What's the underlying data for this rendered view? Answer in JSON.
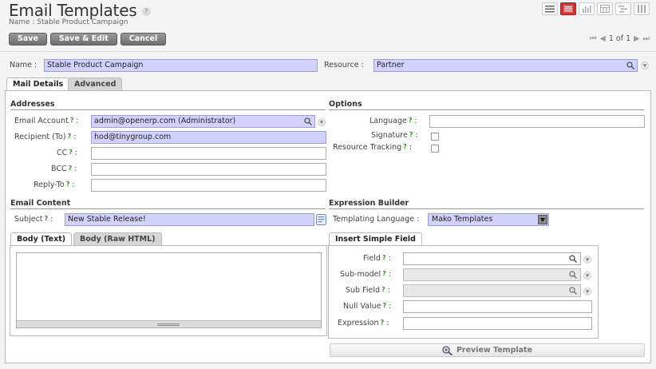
{
  "header": {
    "title": "Email Templates",
    "help_glyph": "?",
    "subtitle": "Name : Stable Product Campaign"
  },
  "view_switcher": {
    "icons": [
      "list-view-icon",
      "form-view-icon",
      "graph-view-icon",
      "calendar-view-icon",
      "gantt-view-icon",
      "kanban-view-icon"
    ],
    "active_index": 1
  },
  "toolbar": {
    "save_label": "Save",
    "save_edit_label": "Save & Edit",
    "cancel_label": "Cancel"
  },
  "pager": {
    "count": "1 of 1"
  },
  "form": {
    "name_label": "Name :",
    "name_value": "Stable Product Campaign",
    "resource_label": "Resource :",
    "resource_value": "Partner"
  },
  "tabs": {
    "mail_details": "Mail Details",
    "advanced": "Advanced"
  },
  "addresses": {
    "title": "Addresses",
    "email_account_label": "Email Account",
    "email_account_value": "admin@openerp.com (Administrator)",
    "recipient_label": "Recipient (To)",
    "recipient_value": "hod@tinygroup.com",
    "cc_label": "CC",
    "bcc_label": "BCC",
    "reply_to_label": "Reply-To"
  },
  "options": {
    "title": "Options",
    "language_label": "Language",
    "signature_label": "Signature",
    "resource_tracking_label": "Resource Tracking"
  },
  "email_content": {
    "title": "Email Content",
    "subject_label": "Subject",
    "subject_value": "New Stable Release!",
    "body_text_tab": "Body (Text)",
    "body_html_tab": "Body (Raw HTML)"
  },
  "expression_builder": {
    "title": "Expression Builder",
    "templating_label": "Templating Language :",
    "templating_value": "Mako Templates",
    "insert_tab": "Insert Simple Field",
    "field_label": "Field",
    "sub_model_label": "Sub-model",
    "sub_field_label": "Sub Field",
    "null_value_label": "Null Value",
    "expression_label": "Expression",
    "preview_label": "Preview Template"
  },
  "colors": {
    "required_field": "#d2d2ff",
    "help_mark": "#3a8a2a",
    "active_view": "#cc3333"
  }
}
